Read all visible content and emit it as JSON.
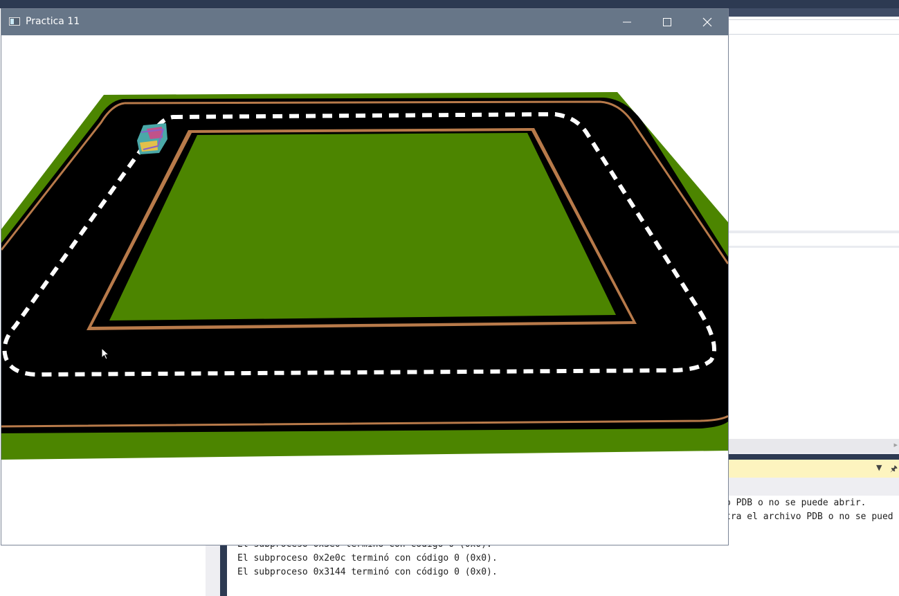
{
  "window": {
    "title": "Practica 11",
    "controls": {
      "minimize": "minimize-icon",
      "maximize": "maximize-icon",
      "close": "close-icon"
    },
    "icon": "app-window-icon"
  },
  "scene": {
    "description_icons": [
      "grass-field",
      "race-track",
      "car-model"
    ],
    "colors": {
      "grass": "#4c8500",
      "asphalt": "#000000",
      "curb": "#b87a4a",
      "lane_dash": "#ffffff",
      "background": "#ffffff"
    }
  },
  "output_panel": {
    "lines": [
      "o PDB o no se puede abrir.",
      "tra el archivo PDB o no se pued",
      "El subproceso 0x3e0 terminó con código 0 (0x0).",
      "El subproceso 0x2e0c terminó con código 0 (0x0).",
      "El subproceso 0x3144 terminó con código 0 (0x0)."
    ]
  }
}
